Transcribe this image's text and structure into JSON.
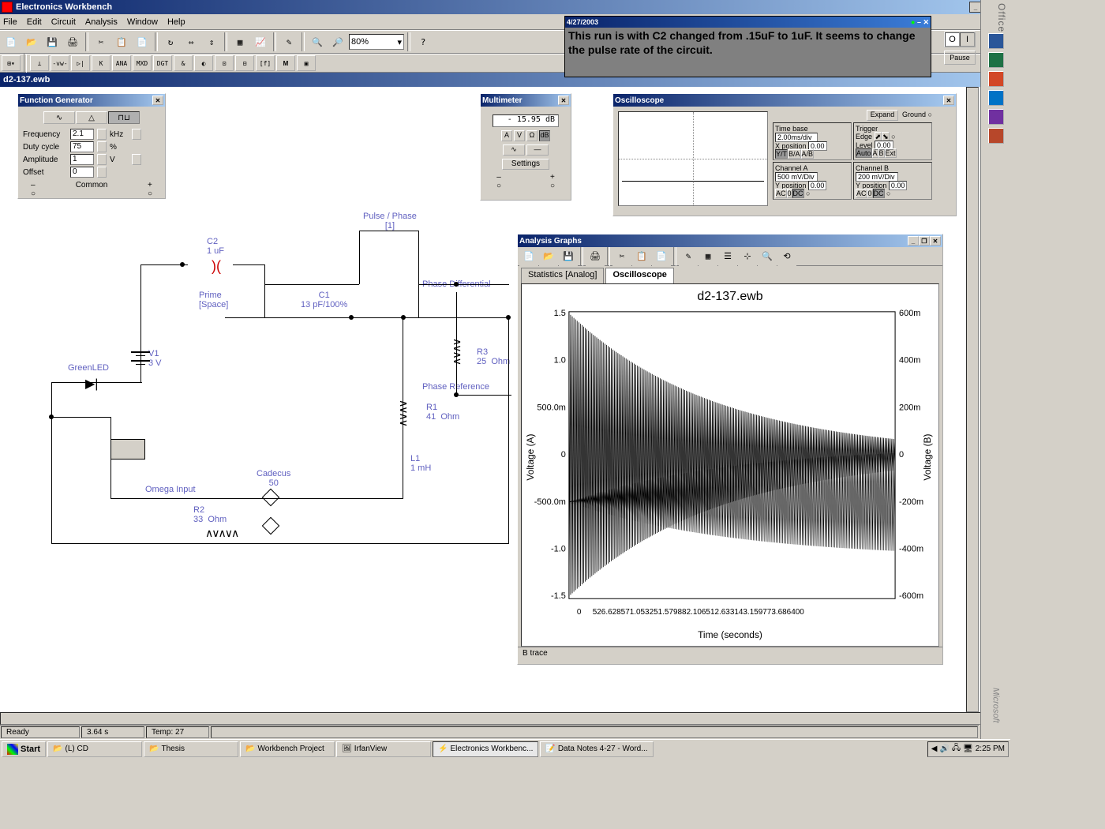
{
  "app": {
    "title": "Electronics Workbench"
  },
  "menu": [
    "File",
    "Edit",
    "Circuit",
    "Analysis",
    "Window",
    "Help"
  ],
  "zoom": "80%",
  "doc_title": "d2-137.ewb",
  "sticky": {
    "date": "4/27/2003",
    "text": "This run is with C2 changed from .15uF to 1uF.  It seems to change the pulse rate of the circuit."
  },
  "sim": {
    "pause": "Pause"
  },
  "funcgen": {
    "title": "Function Generator",
    "rows": {
      "freq": {
        "label": "Frequency",
        "value": "2.1",
        "unit": "kHz"
      },
      "duty": {
        "label": "Duty cycle",
        "value": "75",
        "unit": "%"
      },
      "amp": {
        "label": "Amplitude",
        "value": "1",
        "unit": "V"
      },
      "off": {
        "label": "Offset",
        "value": "0",
        "unit": ""
      }
    },
    "common": "Common"
  },
  "multimeter": {
    "title": "Multimeter",
    "readout": "- 15.95   dB",
    "settings": "Settings"
  },
  "oscope": {
    "title": "Oscilloscope",
    "expand": "Expand",
    "ground": "Ground",
    "timebase": {
      "label": "Time base",
      "value": "2.00ms/div",
      "xpos_l": "X position",
      "xpos_v": "0.00",
      "yt": "Y/T",
      "ba": "B/A",
      "ab": "A/B"
    },
    "chA": {
      "label": "Channel A",
      "value": "500 mV/Div",
      "ypos_l": "Y position",
      "ypos_v": "0.00",
      "ac": "AC",
      "zero": "0",
      "dc": "DC"
    },
    "chB": {
      "label": "Channel B",
      "value": "200 mV/Div",
      "ypos_l": "Y position",
      "ypos_v": "0.00",
      "ac": "AC",
      "zero": "0",
      "dc": "DC"
    },
    "trigger": {
      "label": "Trigger",
      "edge": "Edge",
      "level_l": "Level",
      "level_v": "0.00",
      "auto": "Auto",
      "a": "A",
      "b": "B",
      "ext": "Ext"
    }
  },
  "schematic": {
    "c2": "C2\n1 uF",
    "c1": "C1\n13 pF/100%",
    "prime": "Prime\n[Space]",
    "pulse": "Pulse / Phase\n[1]",
    "v1": "V1\n3 V",
    "greenled": "GreenLED",
    "r3": "R3\n25  Ohm",
    "r1": "R1\n41  Ohm",
    "l1": "L1\n1 mH",
    "phasediff": "Phase Differential",
    "phaseref": "Phase Reference",
    "cadecus": "Cadecus\n50",
    "omega": "Omega Input",
    "r2": "R2\n33  Ohm"
  },
  "analysis": {
    "title": "Analysis Graphs",
    "tab1": "Statistics [Analog]",
    "tab2": "Oscilloscope",
    "plot_title": "d2-137.ewb",
    "xlabel": "Time (seconds)",
    "ylabelA": "Voltage (A)",
    "ylabelB": "Voltage (B)",
    "y_ticks_a": [
      "1.5",
      "1.0",
      "500.0m",
      "0",
      "-500.0m",
      "-1.0",
      "-1.5"
    ],
    "y_ticks_b": [
      "600m",
      "400m",
      "200m",
      "0",
      "-200m",
      "-400m",
      "-600m"
    ],
    "x_ticks": [
      "0",
      "526.628571.053251.579882.106512.633143.159773.686400"
    ],
    "status": "B trace"
  },
  "statusbar": {
    "ready": "Ready",
    "time": "3.64 s",
    "temp": "Temp: 27"
  },
  "taskbar": {
    "start": "Start",
    "tabs": [
      "(L) CD",
      "Thesis",
      "Workbench Project",
      "IrfanView",
      "Electronics Workbenc...",
      "Data Notes 4-27 - Word..."
    ],
    "clock": "2:25 PM"
  },
  "office": "Office",
  "ms": "Microsoft"
}
